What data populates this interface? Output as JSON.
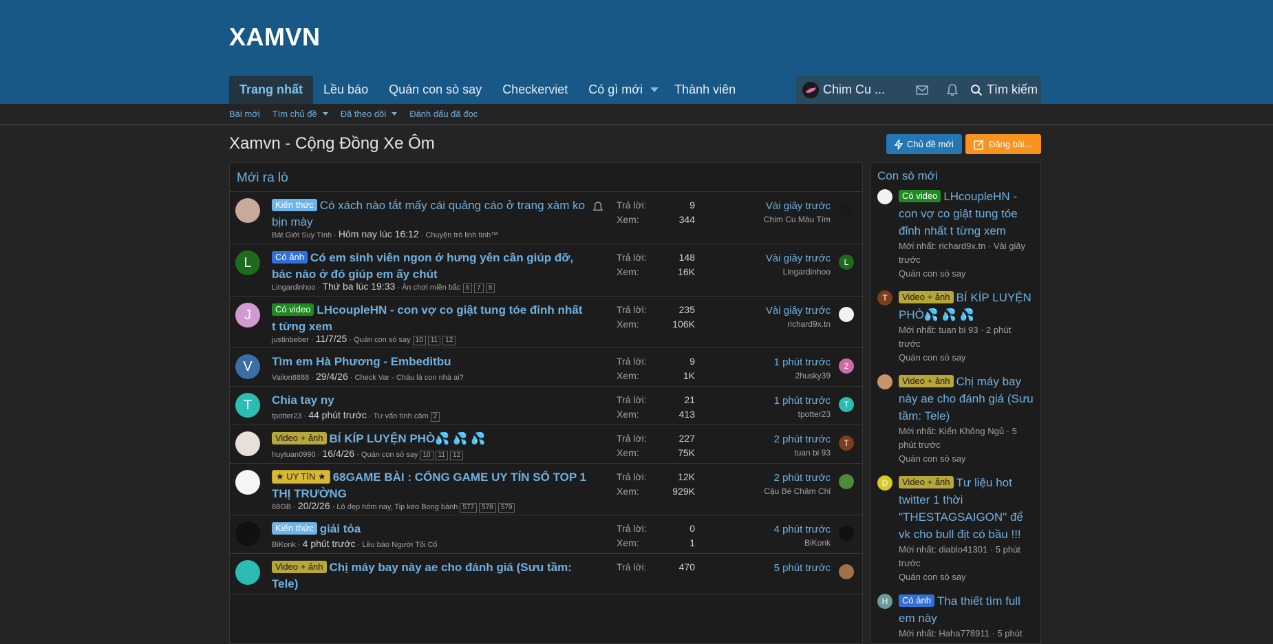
{
  "site": {
    "logo": "XAMVN"
  },
  "nav": {
    "tabs": [
      "Trang nhất",
      "Lều báo",
      "Quán con sò say",
      "Checkerviet",
      "Có gì mới",
      "Thành viên"
    ]
  },
  "user_bar": {
    "username": "Chim Cu ...",
    "search_label": "Tìm kiếm"
  },
  "subnav": {
    "items": [
      "Bài mới",
      "Tìm chủ đề",
      "Đã theo dõi",
      "Đánh dấu đã đọc"
    ]
  },
  "page": {
    "title": "Xamvn - Cộng Đồng Xe Ôm",
    "btn_new_thread": "Chủ đề mới",
    "btn_post": "Đăng bài..."
  },
  "block": {
    "title": "Mới ra lò",
    "reply_label": "Trả lời:",
    "view_label": "Xem:"
  },
  "threads": [
    {
      "avatar_letter": "",
      "avatar_color": "#c9a99a",
      "label": "Kiến thức",
      "label_class": "lbl-kt",
      "title": "Có xách nào tắt mấy cái quảng cáo ở trang xàm ko bịn mày",
      "bold": false,
      "author": "Bát Giới Suy Tình",
      "time": "Hôm nay lúc 16:12",
      "forum": "Chuyện trò linh tinh™",
      "pages": [],
      "replies": "9",
      "views": "344",
      "last_time": "Vài giây trước",
      "last_user": "Chim Cu Màu Tím",
      "last_av_letter": "",
      "last_av_color": "#1a1a1a",
      "bell": true
    },
    {
      "avatar_letter": "L",
      "avatar_color": "#1e6b1e",
      "label": "Có ảnh",
      "label_class": "lbl-ca",
      "title": "Có em sinh viên ngon ở hưng yên cần giúp đỡ, bác nào ở đó giúp em ấy chút",
      "bold": true,
      "author": "Lingardinhoo",
      "time": "Thứ ba lúc 19:33",
      "forum": "Ăn chơi miền bắc",
      "pages": [
        "6",
        "7",
        "8"
      ],
      "replies": "148",
      "views": "16K",
      "last_time": "Vài giây trước",
      "last_user": "Lingardinhoo",
      "last_av_letter": "L",
      "last_av_color": "#1e6b1e",
      "bell": false
    },
    {
      "avatar_letter": "J",
      "avatar_color": "#d19bd1",
      "label": "Có video",
      "label_class": "lbl-cv",
      "title": "LHcoupleHN - con vợ co giật tung tóe đỉnh nhất t từng xem",
      "bold": true,
      "author": "justinbeber",
      "time": "11/7/25",
      "forum": "Quán con sò say",
      "pages": [
        "10",
        "11",
        "12"
      ],
      "replies": "235",
      "views": "106K",
      "last_time": "Vài giây trước",
      "last_user": "richard9x.tn",
      "last_av_letter": "",
      "last_av_color": "#f2f2f2",
      "bell": false
    },
    {
      "avatar_letter": "V",
      "avatar_color": "#3a6ea5",
      "label": "",
      "label_class": "",
      "title": "Tìm em Hà Phương - Embeditbu",
      "bold": true,
      "author": "Vailon8888",
      "time": "29/4/26",
      "forum": "Check Var - Cháu là con nhà ai?",
      "pages": [],
      "replies": "9",
      "views": "1K",
      "last_time": "1 phút trước",
      "last_user": "2husky39",
      "last_av_letter": "2",
      "last_av_color": "#d06aa0",
      "bell": false
    },
    {
      "avatar_letter": "T",
      "avatar_color": "#2bbcb4",
      "label": "",
      "label_class": "",
      "title": "Chia tay ny",
      "bold": true,
      "author": "tpotter23",
      "time": "44 phút trước",
      "forum": "Tư vấn tình cảm",
      "pages": [
        "2"
      ],
      "replies": "21",
      "views": "413",
      "last_time": "1 phút trước",
      "last_user": "tpotter23",
      "last_av_letter": "T",
      "last_av_color": "#2bbcb4",
      "bell": false
    },
    {
      "avatar_letter": "",
      "avatar_color": "#e8e0d8",
      "label": "Video + ảnh",
      "label_class": "lbl-va",
      "title": "BÍ KÍP LUYỆN PHÒ💦 💦 💦",
      "bold": true,
      "author": "huytuan0990",
      "time": "16/4/26",
      "forum": "Quán con sò say",
      "pages": [
        "10",
        "11",
        "12"
      ],
      "replies": "227",
      "views": "75K",
      "last_time": "2 phút trước",
      "last_user": "tuan bi 93",
      "last_av_letter": "T",
      "last_av_color": "#7a3e1c",
      "bell": false
    },
    {
      "avatar_letter": "",
      "avatar_color": "#f5f5f5",
      "label": "★ UY TÍN ★",
      "label_class": "lbl-ut",
      "title": "68GAME BÀI : CỔNG GAME UY TÍN SỐ TOP 1 THỊ TRƯỜNG",
      "bold": true,
      "author": "68GB",
      "time": "20/2/26",
      "forum": "Lô đẹp hôm nay, Tip kèo Bong bánh",
      "pages": [
        "577",
        "578",
        "579"
      ],
      "replies": "12K",
      "views": "929K",
      "last_time": "2 phút trước",
      "last_user": "Cậu Bé Chăm Chỉ",
      "last_av_letter": "",
      "last_av_color": "#4f8a3a",
      "bell": false
    },
    {
      "avatar_letter": "",
      "avatar_color": "#111111",
      "label": "Kiến thức",
      "label_class": "lbl-kt",
      "title": "giải tỏa",
      "bold": true,
      "author": "BiKonk",
      "time": "4 phút trước",
      "forum": "Lều báo Người Tối Cổ",
      "pages": [],
      "replies": "0",
      "views": "1",
      "last_time": "4 phút trước",
      "last_user": "BiKonk",
      "last_av_letter": "",
      "last_av_color": "#111111",
      "bell": false
    },
    {
      "avatar_letter": "",
      "avatar_color": "#2bbcb4",
      "label": "Video + ảnh",
      "label_class": "lbl-va",
      "title": "Chị máy bay này ae cho đánh giá (Sưu tầm: Tele)",
      "bold": true,
      "author": "",
      "time": "",
      "forum": "",
      "pages": [],
      "replies": "470",
      "views": "",
      "last_time": "5 phút trước",
      "last_user": "",
      "last_av_letter": "",
      "last_av_color": "#a0704a",
      "bell": false
    }
  ],
  "sidebar": {
    "title": "Con sò mới",
    "items": [
      {
        "av_letter": "",
        "av_color": "#f2f2f2",
        "label": "Có video",
        "label_class": "lbl-cv",
        "title": "LHcoupleHN - con vợ co giật tung tóe đỉnh nhất t từng xem",
        "latest": "Mới nhất: richard9x.tn · Vài giây trước",
        "forum": "Quán con sò say"
      },
      {
        "av_letter": "T",
        "av_color": "#7a3e1c",
        "label": "Video + ảnh",
        "label_class": "lbl-va",
        "title": "BÍ KÍP LUYỆN PHÒ💦 💦 💦",
        "latest": "Mới nhất: tuan bi 93 · 2 phút trước",
        "forum": "Quán con sò say"
      },
      {
        "av_letter": "",
        "av_color": "#c8956a",
        "label": "Video + ảnh",
        "label_class": "lbl-va",
        "title": "Chị máy bay này ae cho đánh giá (Sưu tầm: Tele)",
        "latest": "Mới nhất: Kiến Không Ngủ · 5 phút trước",
        "forum": "Quán con sò say"
      },
      {
        "av_letter": "D",
        "av_color": "#d8c82a",
        "label": "Video + ảnh",
        "label_class": "lbl-va",
        "title": "Tư liệu hot twitter 1 thời \"THESTAGSAIGON\" để vk cho bull địt có bầu !!!",
        "latest": "Mới nhất: diablo41301 · 5 phút trước",
        "forum": "Quán con sò say"
      },
      {
        "av_letter": "H",
        "av_color": "#6a9a9a",
        "label": "Có ảnh",
        "label_class": "lbl-ca",
        "title": "Tha thiết tìm full em này",
        "latest": "Mới nhất: Haha778911 · 5 phút",
        "forum": ""
      }
    ]
  },
  "colors": {
    "header_bg": "#185886",
    "link": "#6fb0e0",
    "body_bg": "#242424"
  }
}
